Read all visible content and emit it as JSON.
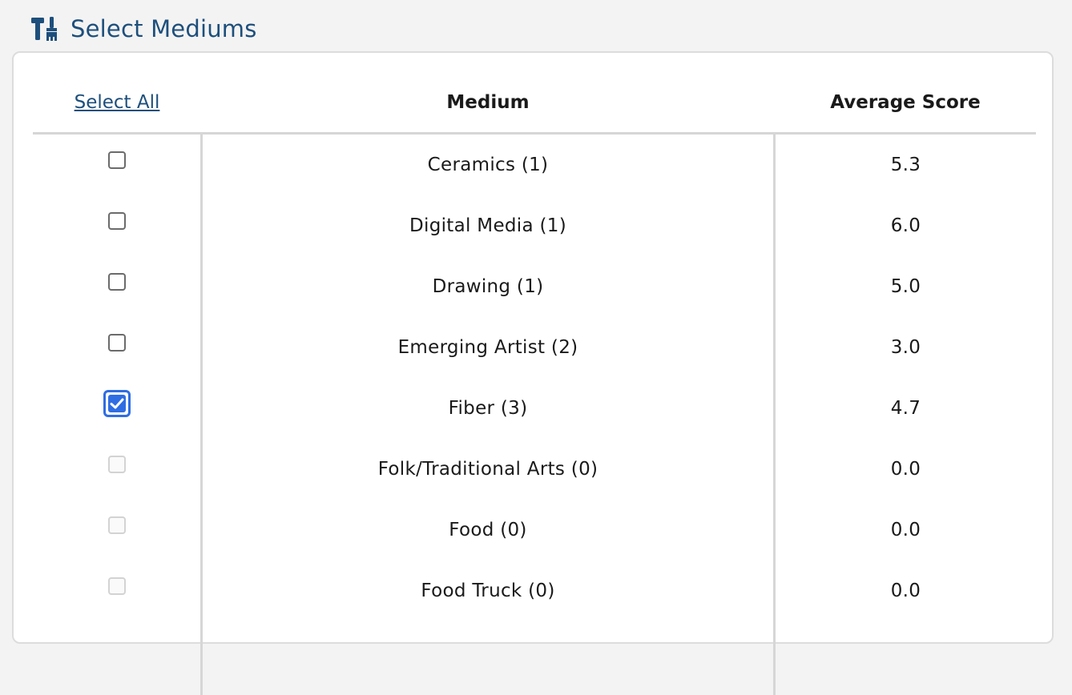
{
  "header": {
    "icon": "tools-icon",
    "title": "Select Mediums"
  },
  "table": {
    "select_all_label": "Select All",
    "col_medium": "Medium",
    "col_score": "Average Score",
    "rows": [
      {
        "medium": "Ceramics (1)",
        "score": "5.3",
        "checked": false,
        "disabled": false
      },
      {
        "medium": "Digital Media (1)",
        "score": "6.0",
        "checked": false,
        "disabled": false
      },
      {
        "medium": "Drawing (1)",
        "score": "5.0",
        "checked": false,
        "disabled": false
      },
      {
        "medium": "Emerging Artist (2)",
        "score": "3.0",
        "checked": false,
        "disabled": false
      },
      {
        "medium": "Fiber (3)",
        "score": "4.7",
        "checked": true,
        "disabled": false
      },
      {
        "medium": "Folk/Traditional Arts (0)",
        "score": "0.0",
        "checked": false,
        "disabled": true
      },
      {
        "medium": "Food (0)",
        "score": "0.0",
        "checked": false,
        "disabled": true
      },
      {
        "medium": "Food Truck (0)",
        "score": "0.0",
        "checked": false,
        "disabled": true
      }
    ]
  },
  "colors": {
    "header_blue": "#1d4f7c",
    "checkbox_blue": "#2f6de3"
  }
}
